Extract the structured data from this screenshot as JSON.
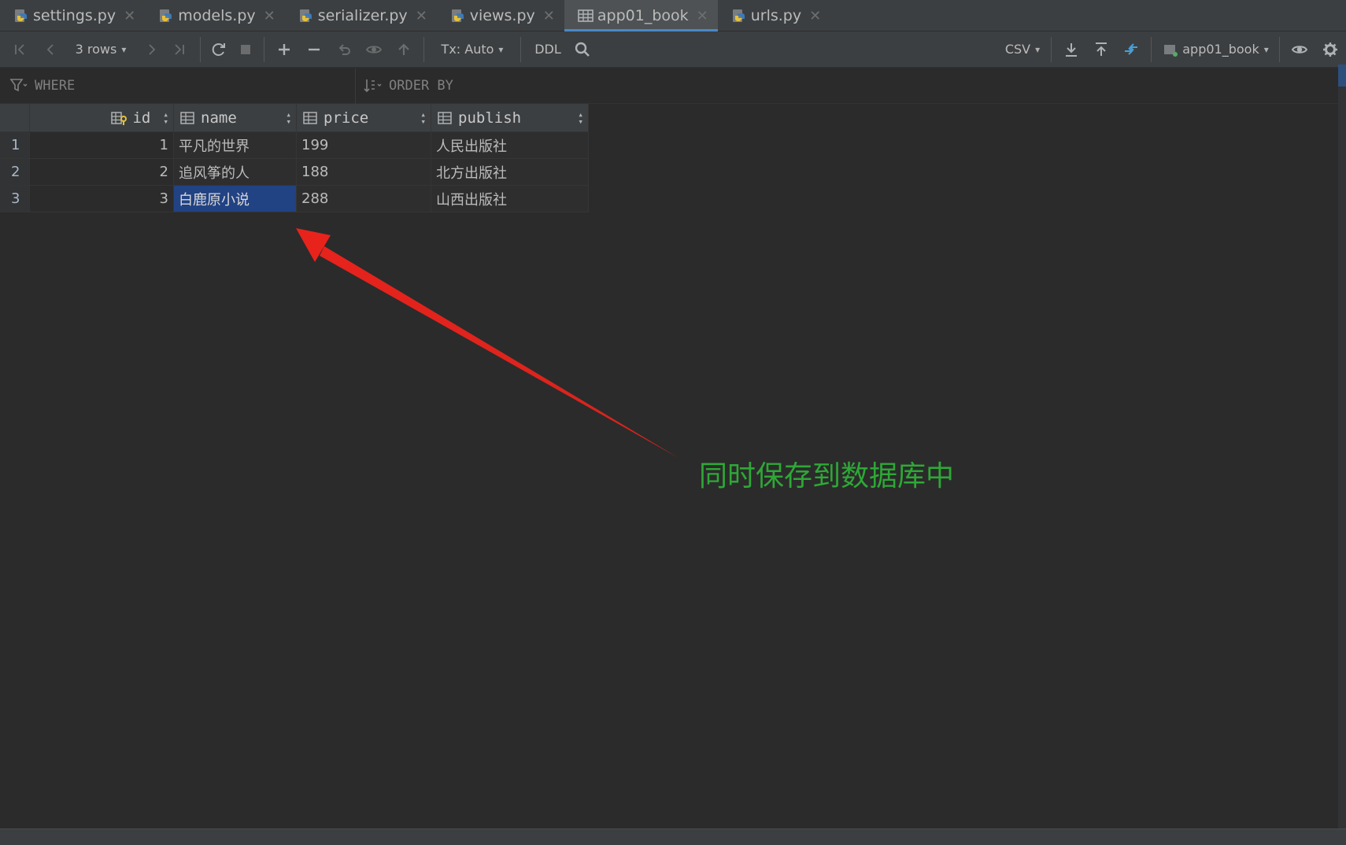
{
  "tabs": [
    {
      "label": "settings.py",
      "icon": "python-file-icon",
      "active": false
    },
    {
      "label": "models.py",
      "icon": "python-file-icon",
      "active": false
    },
    {
      "label": "serializer.py",
      "icon": "python-file-icon",
      "active": false
    },
    {
      "label": "views.py",
      "icon": "python-file-icon",
      "active": false
    },
    {
      "label": "app01_book",
      "icon": "table-icon",
      "active": true
    },
    {
      "label": "urls.py",
      "icon": "python-file-icon",
      "active": false
    }
  ],
  "toolbar": {
    "rows_label": "3 rows",
    "tx_label": "Tx: Auto",
    "ddl_label": "DDL",
    "export_format": "CSV",
    "datasource_label": "app01_book"
  },
  "filter": {
    "where_label": "WHERE",
    "order_label": "ORDER BY"
  },
  "table": {
    "columns": [
      "id",
      "name",
      "price",
      "publish"
    ],
    "rows": [
      {
        "num": "1",
        "id": "1",
        "name": "平凡的世界",
        "price": "199",
        "publish": "人民出版社"
      },
      {
        "num": "2",
        "id": "2",
        "name": "追风筝的人",
        "price": "188",
        "publish": "北方出版社"
      },
      {
        "num": "3",
        "id": "3",
        "name": "白鹿原小说",
        "price": "288",
        "publish": "山西出版社"
      }
    ]
  },
  "annotation": {
    "text": "同时保存到数据库中",
    "color": "#2ea836",
    "arrow_color": "#e8231c"
  },
  "colors": {
    "background": "#2b2b2b",
    "panel": "#3c3f41",
    "selection": "#214283",
    "accent": "#4a88c7"
  }
}
